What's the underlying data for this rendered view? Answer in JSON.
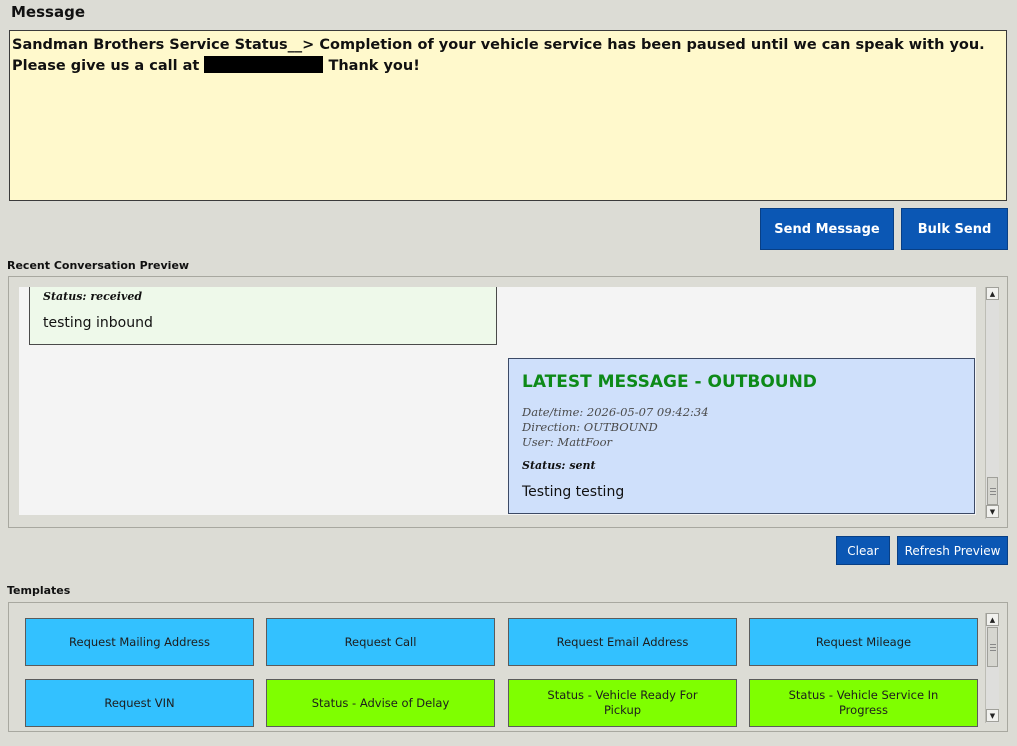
{
  "message": {
    "label": "Message",
    "text_before": "Sandman Brothers Service Status__> Completion of your vehicle service has been paused until we can speak with you. Please give us a call at",
    "text_after": "Thank you!"
  },
  "actions": {
    "send_label": "Send Message",
    "bulk_label": "Bulk Send"
  },
  "preview": {
    "label": "Recent Conversation Preview",
    "inbound": {
      "status": "Status: received",
      "body": "testing inbound"
    },
    "outbound": {
      "heading": "LATEST MESSAGE - OUTBOUND",
      "datetime": "Date/time: 2026-05-07 09:42:34",
      "direction": "Direction: OUTBOUND",
      "user": "User: MattFoor",
      "status": "Status: sent",
      "body": "Testing testing"
    },
    "clear_label": "Clear",
    "refresh_label": "Refresh Preview"
  },
  "templates": {
    "label": "Templates",
    "items": [
      {
        "label": "Request Mailing Address",
        "color": "#33c1ff"
      },
      {
        "label": "Request Call",
        "color": "#33c1ff"
      },
      {
        "label": "Request Email Address",
        "color": "#33c1ff"
      },
      {
        "label": "Request Mileage",
        "color": "#33c1ff"
      },
      {
        "label": "Request VIN",
        "color": "#33c1ff"
      },
      {
        "label": "Status - Advise of Delay",
        "color": "#7fff00"
      },
      {
        "label": "Status - Vehicle Ready For Pickup",
        "color": "#7fff00"
      },
      {
        "label": "Status - Vehicle Service In Progress",
        "color": "#7fff00"
      }
    ]
  },
  "colors": {
    "button_blue": "#0b57b4",
    "outbound_heading": "#0d8a18",
    "message_bg": "#fff9cc"
  }
}
